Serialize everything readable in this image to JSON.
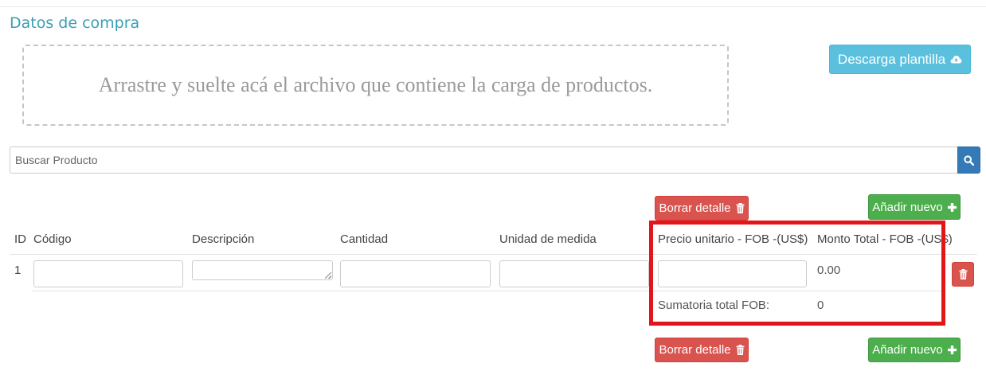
{
  "section": {
    "title": "Datos de compra"
  },
  "dropzone": {
    "text": "Arrastre y suelte acá el archivo que contiene la carga de productos."
  },
  "download": {
    "label": "Descarga plantilla",
    "icon": "cloud-upload-icon"
  },
  "search": {
    "placeholder": "Buscar Producto",
    "value": "",
    "button_icon": "search-icon"
  },
  "actions": {
    "delete_label": "Borrar detalle",
    "delete_icon": "trash-icon",
    "add_label": "Añadir nuevo",
    "add_icon": "plus-icon"
  },
  "table": {
    "columns": [
      "ID",
      "Código",
      "Descripción",
      "Cantidad",
      "Unidad de medida",
      "Precio unitario - FOB -(US$)",
      "Monto Total - FOB -(US$)"
    ],
    "rows": [
      {
        "id": "1",
        "codigo": "",
        "descripcion": "",
        "cantidad": "",
        "unidad": "",
        "precio": "",
        "monto": "0.00"
      }
    ],
    "summary": {
      "label": "Sumatoria total FOB:",
      "value": "0"
    }
  },
  "colors": {
    "title": "#3a9fb4",
    "info": "#5bc0de",
    "danger": "#d9534f",
    "success": "#4cae4c",
    "primary": "#337ab7",
    "highlight": "#e4141b"
  }
}
